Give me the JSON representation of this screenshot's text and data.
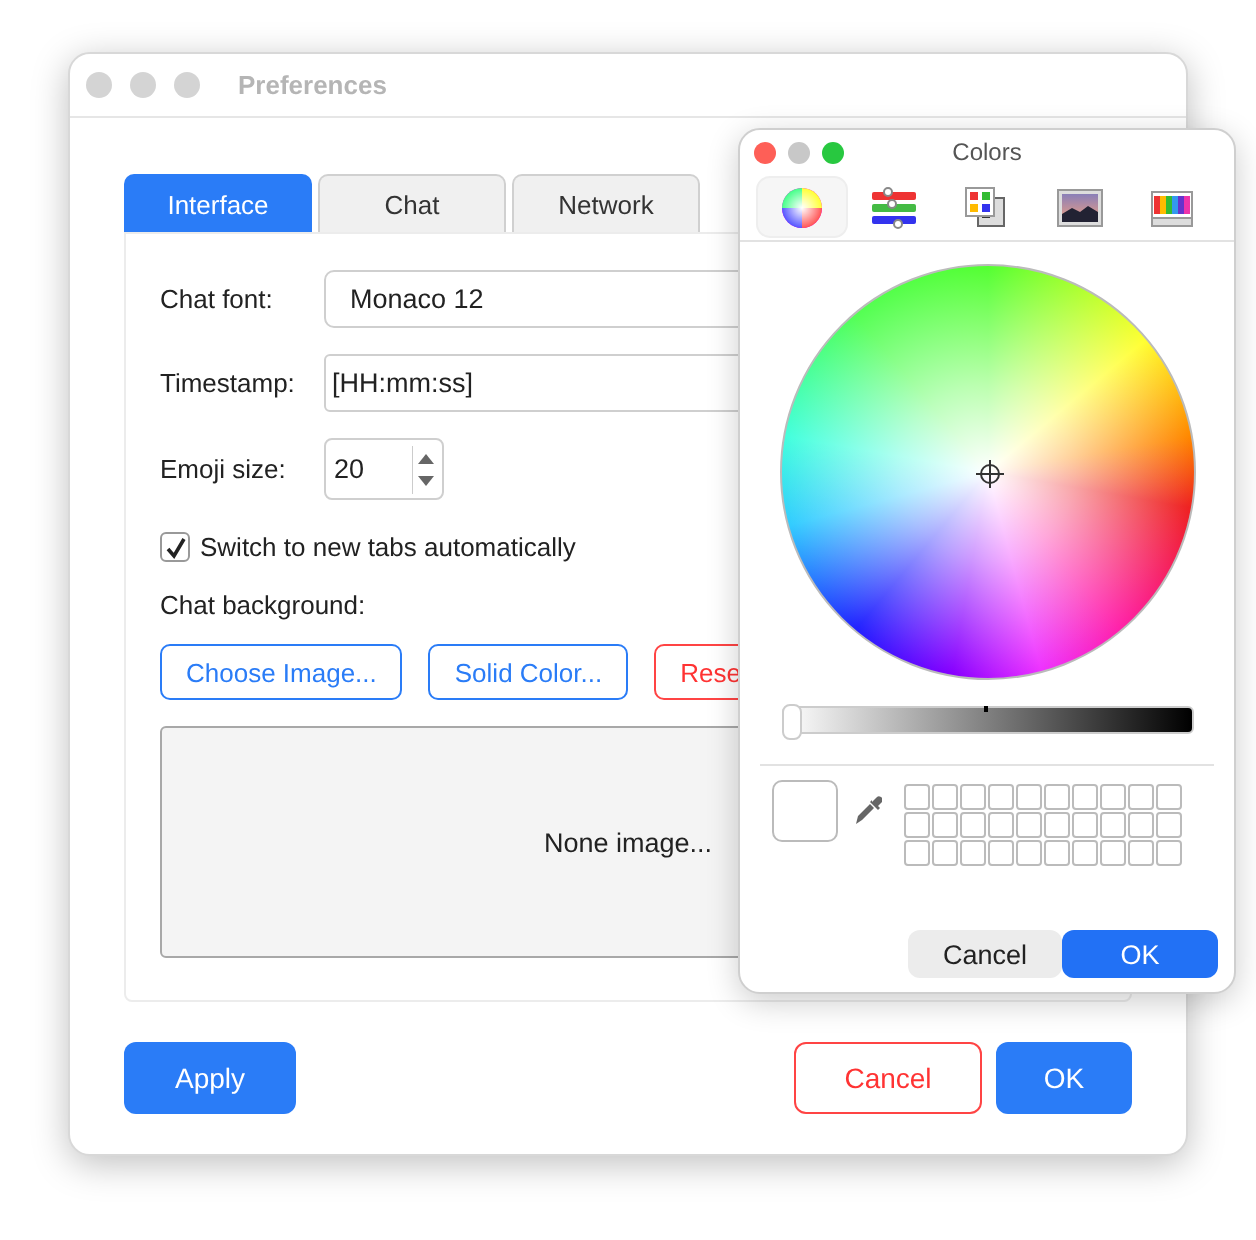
{
  "window": {
    "title": "Preferences",
    "active": false
  },
  "tabs": [
    {
      "label": "Interface",
      "selected": true
    },
    {
      "label": "Chat",
      "selected": false
    },
    {
      "label": "Network",
      "selected": false
    }
  ],
  "form": {
    "chat_font": {
      "label": "Chat font:",
      "value": "Monaco 12"
    },
    "timestamp": {
      "label": "Timestamp:",
      "value": "[HH:mm:ss]"
    },
    "emoji_size": {
      "label": "Emoji size:",
      "value": "20"
    },
    "switch_tabs": {
      "label": "Switch to new tabs automatically",
      "checked": true
    },
    "chat_background": {
      "label": "Chat background:",
      "buttons": [
        {
          "label": "Choose Image...",
          "kind": "normal"
        },
        {
          "label": "Solid Color...",
          "kind": "normal"
        },
        {
          "label": "Rese",
          "kind": "danger"
        }
      ],
      "preview": "None image..."
    }
  },
  "buttons": [
    {
      "label": "Apply",
      "kind": "primary"
    },
    {
      "label": "Cancel",
      "kind": "danger"
    },
    {
      "label": "OK",
      "kind": "primary"
    }
  ],
  "color_panel": {
    "title": "Colors",
    "active": true,
    "modes": [
      {
        "kind": "wheel",
        "selected": true
      },
      {
        "kind": "sliders",
        "selected": false
      },
      {
        "kind": "palettes",
        "selected": false
      },
      {
        "kind": "image",
        "selected": false
      },
      {
        "kind": "pencils",
        "selected": false
      }
    ],
    "brightness": {
      "level": 0
    },
    "buttons": [
      {
        "label": "Cancel",
        "kind": "secondary"
      },
      {
        "label": "OK",
        "kind": "primary"
      }
    ]
  }
}
